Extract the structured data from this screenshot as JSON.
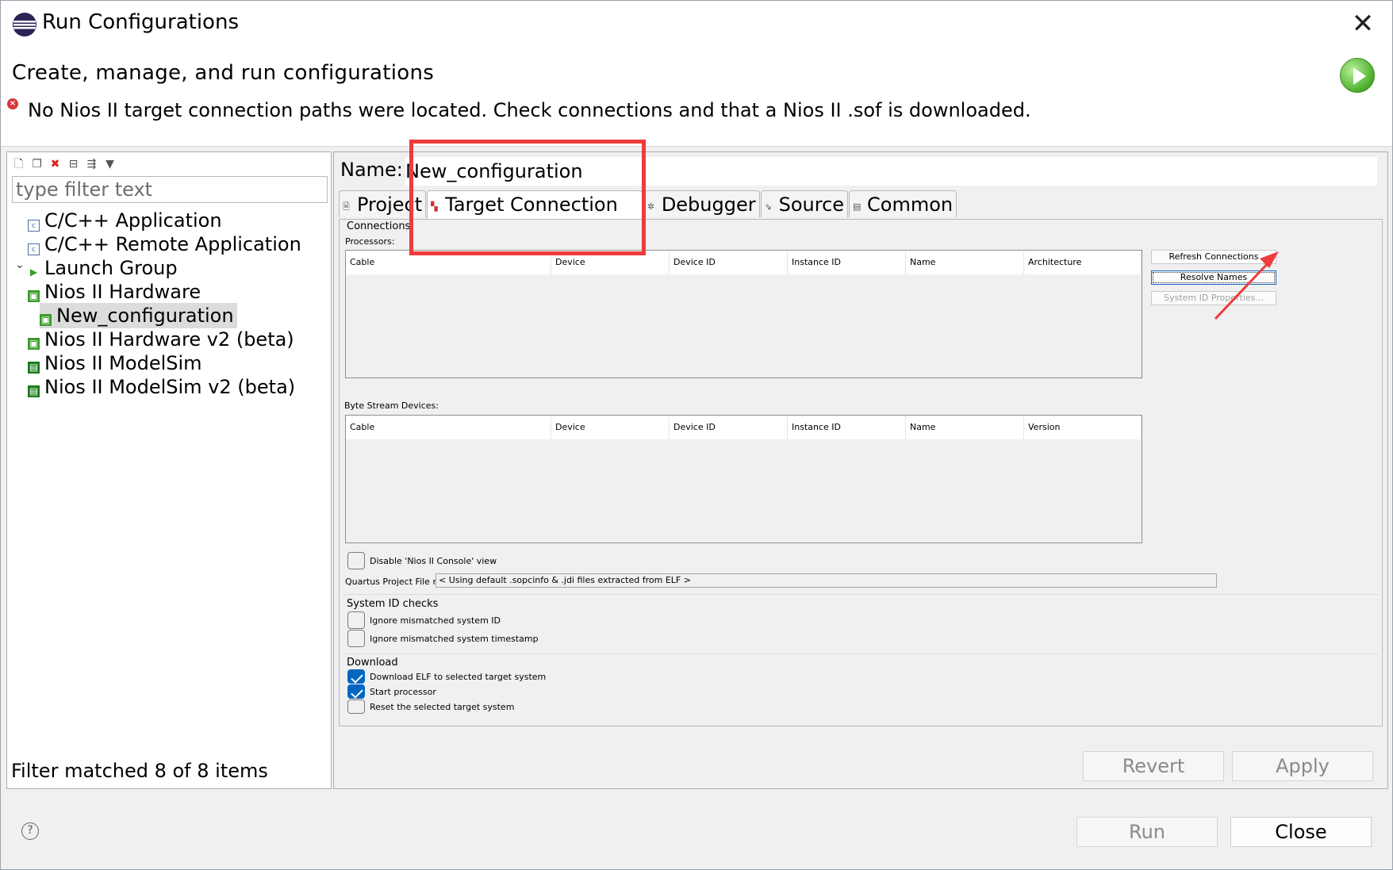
{
  "window": {
    "title": "Run Configurations",
    "header_title": "Create, manage, and run configurations",
    "error_message": "No Nios II target connection paths were located. Check connections and that a Nios II .sof is downloaded."
  },
  "left": {
    "filter_placeholder": "type filter text",
    "items": [
      {
        "label": "C/C++ Application",
        "icon": "c-app-icon"
      },
      {
        "label": "C/C++ Remote Application",
        "icon": "c-remote-icon"
      },
      {
        "label": "Launch Group",
        "icon": "launch-group-icon"
      },
      {
        "label": "Nios II Hardware",
        "icon": "nios-hardware-icon"
      },
      {
        "label": "New_configuration",
        "icon": "nios-config-icon"
      },
      {
        "label": "Nios II Hardware v2 (beta)",
        "icon": "nios-hardware-icon"
      },
      {
        "label": "Nios II ModelSim",
        "icon": "modelsim-icon"
      },
      {
        "label": "Nios II ModelSim v2 (beta)",
        "icon": "modelsim-icon"
      }
    ],
    "filter_status": "Filter matched 8 of 8 items"
  },
  "right": {
    "name_label": "Name:",
    "name_value": "New_configuration",
    "tabs": [
      {
        "label": "Project",
        "icon": "page-icon"
      },
      {
        "label": "Target Connection",
        "icon": "target-icon"
      },
      {
        "label": "Debugger",
        "icon": "bug-icon"
      },
      {
        "label": "Source",
        "icon": "source-icon"
      },
      {
        "label": "Common",
        "icon": "common-icon"
      }
    ],
    "connections_label": "Connections",
    "processors_label": "Processors:",
    "processors_columns": [
      "Cable",
      "Device",
      "Device ID",
      "Instance ID",
      "Name",
      "Architecture"
    ],
    "byte_stream_label": "Byte Stream Devices:",
    "byte_stream_columns": [
      "Cable",
      "Device",
      "Device ID",
      "Instance ID",
      "Name",
      "Version"
    ],
    "refresh_connections": "Refresh Connections",
    "resolve_names": "Resolve Names",
    "system_id_properties": "System ID Properties...",
    "disable_console": "Disable 'Nios II Console' view",
    "quartus_label": "Quartus Project File name:",
    "quartus_value": "< Using default .sopcinfo & .jdi files extracted from ELF >",
    "system_id_checks": "System ID checks",
    "ignore_system_id": "Ignore mismatched system ID",
    "ignore_timestamp": "Ignore mismatched system timestamp",
    "download_label": "Download",
    "download_elf": "Download ELF to selected target system",
    "start_processor": "Start processor",
    "reset_target": "Reset the selected target system",
    "revert": "Revert",
    "apply": "Apply"
  },
  "footer": {
    "run": "Run",
    "close": "Close",
    "help": "?"
  },
  "colors": {
    "annotation": "#ee3b3b",
    "checkbox_accent": "#0067c0"
  }
}
